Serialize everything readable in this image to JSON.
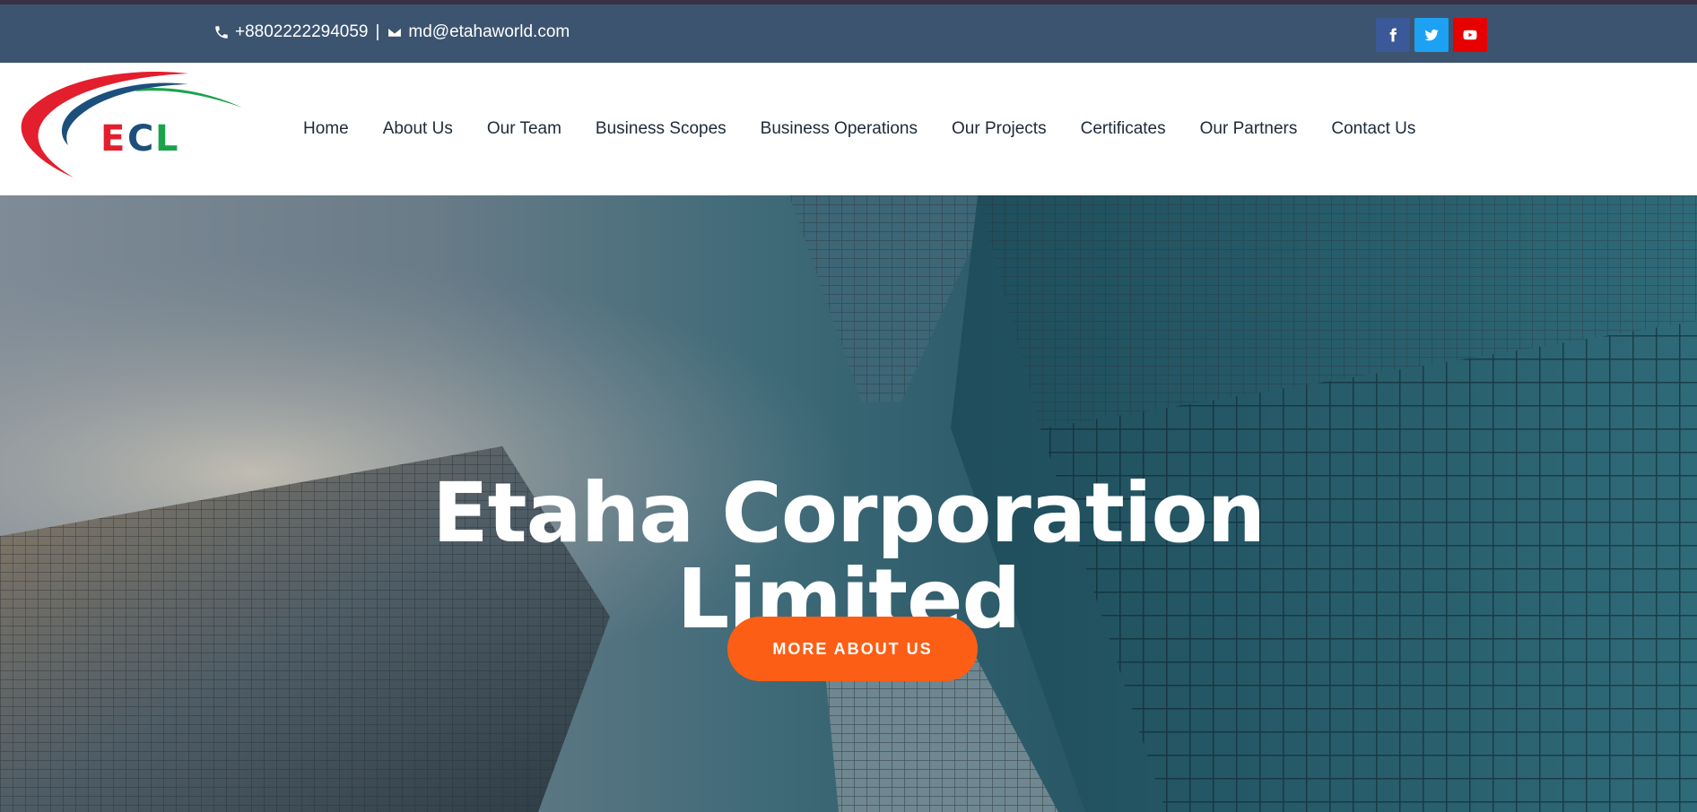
{
  "topbar": {
    "phone": "+8802222294059",
    "separator": "|",
    "email": "md@etahaworld.com",
    "social": [
      {
        "name": "facebook",
        "icon": "facebook-icon",
        "color": "#3b5998"
      },
      {
        "name": "twitter",
        "icon": "twitter-icon",
        "color": "#1da1f2"
      },
      {
        "name": "youtube",
        "icon": "youtube-icon",
        "color": "#e60000"
      }
    ]
  },
  "logo": {
    "text": "ECL",
    "colors": {
      "red": "#e31e2d",
      "blue": "#1d4f7c",
      "green": "#1aa34a"
    }
  },
  "nav": {
    "items": [
      {
        "label": "Home"
      },
      {
        "label": "About Us"
      },
      {
        "label": "Our Team"
      },
      {
        "label": "Business Scopes"
      },
      {
        "label": "Business Operations"
      },
      {
        "label": "Our Projects"
      },
      {
        "label": "Certificates"
      },
      {
        "label": "Our Partners"
      },
      {
        "label": "Contact Us"
      }
    ]
  },
  "hero": {
    "title_line1": "Etaha Corporation",
    "title_line2": "Limited",
    "button_label": "MORE ABOUT US",
    "button_color": "#fd5e15"
  }
}
